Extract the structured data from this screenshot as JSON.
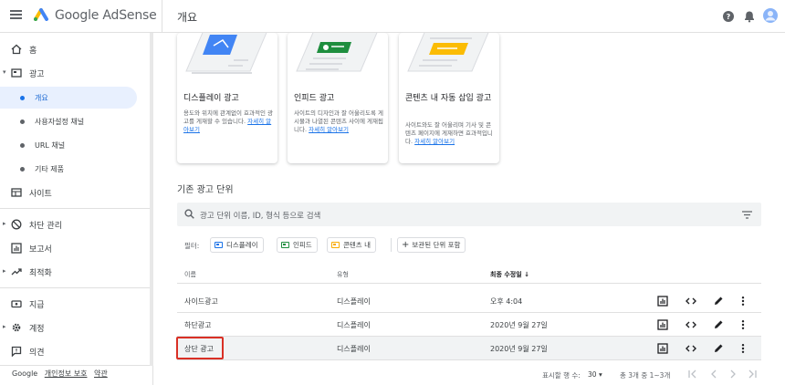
{
  "header": {
    "brand": "Google AdSense",
    "page_title": "개요"
  },
  "sidebar": {
    "items": [
      {
        "label": "홈",
        "icon": "home-icon"
      },
      {
        "label": "광고",
        "icon": "ads-icon"
      },
      {
        "label": "사이트",
        "icon": "sites-icon"
      },
      {
        "label": "차단 관리",
        "icon": "block-icon"
      },
      {
        "label": "보고서",
        "icon": "reports-icon"
      },
      {
        "label": "최적화",
        "icon": "optimize-icon"
      },
      {
        "label": "지급",
        "icon": "payments-icon"
      },
      {
        "label": "계정",
        "icon": "account-icon"
      },
      {
        "label": "의견",
        "icon": "feedback-icon"
      }
    ],
    "subitems": [
      {
        "label": "개요",
        "active": true
      },
      {
        "label": "사용자설정 채널"
      },
      {
        "label": "URL 채널"
      },
      {
        "label": "기타 제품"
      }
    ],
    "footer": {
      "google": "Google",
      "privacy": "개인정보 보호",
      "terms": "약관"
    }
  },
  "cards": [
    {
      "title": "디스플레이 광고",
      "desc": "용도와 위치에 관계없이 효과적인 광고를 게재할 수 있습니다.",
      "link": "자세히 알아보기"
    },
    {
      "title": "인피드 광고",
      "desc": "사이트의 디자인과 잘 어울리도록 게시물과 나열된 콘텐츠 사이에 게재됩니다.",
      "link": "자세히 알아보기"
    },
    {
      "title": "콘텐츠 내 자동 삽입 광고",
      "desc": "사이트와도 잘 어울리며 기사 및 콘텐츠 페이지에 게재하면 효과적입니다.",
      "link": "자세히 알아보기"
    }
  ],
  "existing": {
    "title": "기존 광고 단위",
    "search_placeholder": "광고 단위 이름, ID, 형식 등으로 검색",
    "filter_label": "필터:",
    "chips": [
      "디스플레이",
      "인피드",
      "콘텐츠 내"
    ],
    "include_archived": "보관된 단위 포함",
    "columns": {
      "name": "이름",
      "type": "유형",
      "updated": "최종 수정일 ↓"
    },
    "rows": [
      {
        "name": "사이드광고",
        "type": "디스플레이",
        "updated": "오후 4:04"
      },
      {
        "name": "하단광고",
        "type": "디스플레이",
        "updated": "2020년 9월 27일"
      },
      {
        "name": "상단 광고",
        "type": "디스플레이",
        "updated": "2020년 9월 27일"
      }
    ]
  },
  "pager": {
    "rows_label": "표시할 행 수:",
    "rows_value": "30",
    "range": "총 3개 중 1~3개"
  },
  "colors": {
    "accent": "#1a73e8",
    "active_bg": "#e8f0fe",
    "highlight": "#d93025",
    "display_chip": "#1a73e8",
    "infeed_chip": "#1e8e3e",
    "incontent_chip": "#f9ab00"
  }
}
